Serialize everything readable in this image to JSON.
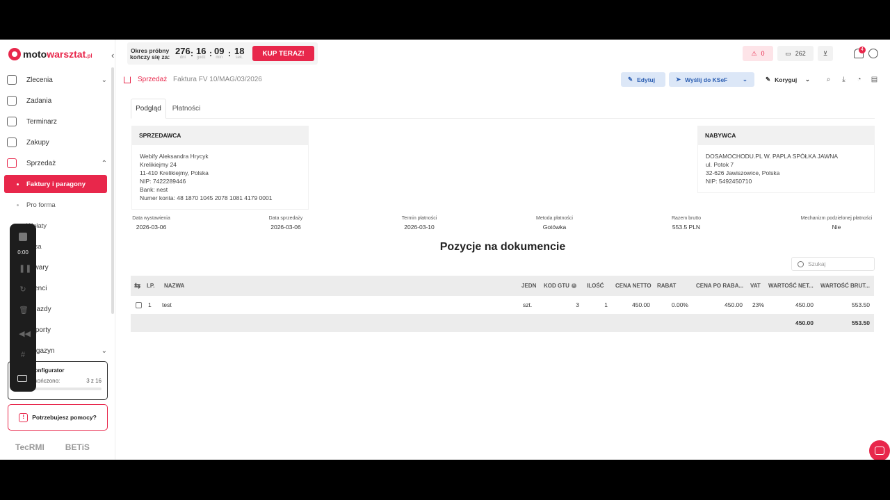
{
  "brand": {
    "part1": "moto",
    "part2": "warsztat",
    "tld": ".pl"
  },
  "sidebar": {
    "items": [
      {
        "label": "Zlecenia"
      },
      {
        "label": "Zadania"
      },
      {
        "label": "Terminarz"
      },
      {
        "label": "Zakupy"
      },
      {
        "label": "Sprzedaż"
      }
    ],
    "sub_items": [
      {
        "label": "Faktury i paragony"
      },
      {
        "label": "Pro forma"
      },
      {
        "label": "Wpłaty"
      },
      {
        "label": "Kasa"
      },
      {
        "label": "Towary"
      },
      {
        "label": "Klienci"
      },
      {
        "label": "Pojazdy"
      },
      {
        "label": "Raporty"
      },
      {
        "label": "Magazyn"
      }
    ],
    "configurator": {
      "title": "Konfigurator",
      "progress_label": "Ukończono:",
      "progress_value": "3 z 16",
      "progress_fraction": 0.1875
    },
    "help": "Potrzebujesz pomocy?",
    "partners": [
      "TecRMI",
      "BETiS"
    ]
  },
  "recorder": {
    "time": "0:00"
  },
  "trial": {
    "label_line1": "Okres próbny",
    "label_line2": "kończy się za:",
    "days": "276",
    "days_unit": "dni",
    "hours": "16",
    "hours_unit": "godz",
    "minutes": "09",
    "minutes_unit": "min",
    "seconds": "18",
    "seconds_unit": "sek.",
    "buy_label": "KUP TERAZ!"
  },
  "top": {
    "alerts_count": "0",
    "messages_count": "262",
    "notifications_badge": "4"
  },
  "breadcrumb": {
    "section": "Sprzedaż",
    "current": "Faktura FV 10/MAG/03/2026"
  },
  "toolbar": {
    "edit": "Edytuj",
    "send_ksef": "Wyślij do KSeF",
    "correct": "Koryguj"
  },
  "tabs": {
    "preview": "Podgląd",
    "payments": "Płatności"
  },
  "seller": {
    "header": "SPRZEDAWCA",
    "lines": [
      "Webify Aleksandra Hrycyk",
      "Krelikiejmy 24",
      "11-410 Krelikiejmy, Polska",
      "NIP: 7422289446",
      "Bank: nest",
      "Numer konta: 48 1870 1045 2078 1081 4179 0001"
    ]
  },
  "buyer": {
    "header": "NABYWCA",
    "lines": [
      "DOSAMOCHODU.PL W. PAPLA SPÓŁKA JAWNA",
      "ul. Potok 7",
      "32-626 Jawiszowice, Polska",
      "NIP: 5492450710"
    ]
  },
  "details": [
    {
      "label": "Data wystawienia",
      "value": "2026-03-06"
    },
    {
      "label": "Data sprzedaży",
      "value": "2026-03-06"
    },
    {
      "label": "Termin płatności",
      "value": "2026-03-10"
    },
    {
      "label": "Metoda płatności",
      "value": "Gotówka"
    },
    {
      "label": "Razem brutto",
      "value": "553.5 PLN"
    },
    {
      "label": "Mechanizm podzielonej płatności",
      "value": "Nie"
    }
  ],
  "positions": {
    "title": "Pozycje na dokumencie",
    "search_placeholder": "Szukaj",
    "columns": {
      "lp": "LP.",
      "name": "NAZWA",
      "unit": "JEDN",
      "gtu": "KOD GTU",
      "qty": "ILOŚĆ",
      "net_price": "CENA NETTO",
      "discount": "RABAT",
      "price_after": "CENA PO RABA...",
      "vat": "VAT",
      "net_value": "WARTOŚĆ NET...",
      "gross_value": "WARTOŚĆ BRUT..."
    },
    "rows": [
      {
        "lp": "1",
        "name": "test",
        "unit": "szt.",
        "gtu": "3",
        "qty": "1",
        "net_price": "450.00",
        "discount": "0.00%",
        "price_after": "450.00",
        "vat": "23%",
        "net_value": "450.00",
        "gross_value": "553.50"
      }
    ],
    "totals": {
      "net_value": "450.00",
      "gross_value": "553.50"
    }
  }
}
